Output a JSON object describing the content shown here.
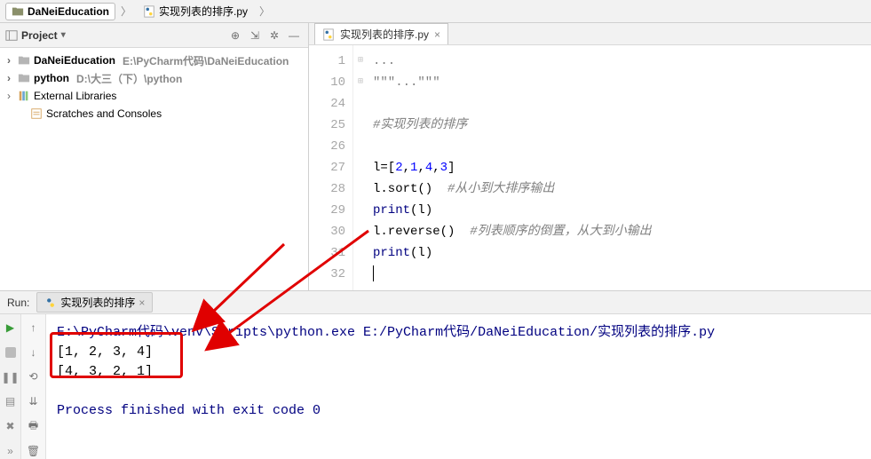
{
  "breadcrumb": {
    "folder": "DaNeiEducation",
    "file": "实现列表的排序.py"
  },
  "project": {
    "title": "Project",
    "items": [
      {
        "label": "DaNeiEducation",
        "note": "E:\\PyCharm代码\\DaNeiEducation",
        "icon": "folder",
        "bold": true,
        "indent": 0
      },
      {
        "label": "python",
        "note": "D:\\大三（下）\\python",
        "icon": "folder",
        "bold": true,
        "indent": 0
      },
      {
        "label": "External Libraries",
        "note": "",
        "icon": "libs",
        "bold": false,
        "indent": 0
      },
      {
        "label": "Scratches and Consoles",
        "note": "",
        "icon": "scratch",
        "bold": false,
        "indent": 1
      }
    ]
  },
  "editor": {
    "tab_label": "实现列表的排序.py",
    "line_numbers": [
      "1",
      "10",
      "24",
      "25",
      "26",
      "27",
      "28",
      "29",
      "30",
      "31",
      "32"
    ],
    "fold_glyphs": [
      "⊞",
      "⊞",
      "",
      "",
      "",
      "",
      "",
      "",
      "",
      "",
      ""
    ],
    "lines_html": [
      "<span class='tok-gray'>...</span>",
      "<span class='tok-gray'>\"\"\"...\"\"\"</span>",
      "",
      "<span class='tok-cm'>#实现列表的排序</span>",
      "",
      "l=[<span class='tok-num'>2</span>,<span class='tok-num'>1</span>,<span class='tok-num'>4</span>,<span class='tok-num'>3</span>]",
      "l.sort()  <span class='tok-cm'>#从小到大排序输出</span>",
      "<span class='tok-builtin'>print</span>(l)",
      "l.reverse()  <span class='tok-cm'>#列表顺序的倒置，从大到小输出</span>",
      "<span class='tok-builtin'>print</span>(l)",
      "<span class='caret'></span>"
    ]
  },
  "run": {
    "label": "Run:",
    "tab": "实现列表的排序",
    "path": "E:\\PyCharm代码\\venv\\Scripts\\python.exe E:/PyCharm代码/DaNeiEducation/实现列表的排序.py",
    "out1": "[1, 2, 3, 4]",
    "out2": "[4, 3, 2, 1]",
    "exit": "Process finished with exit code 0"
  }
}
